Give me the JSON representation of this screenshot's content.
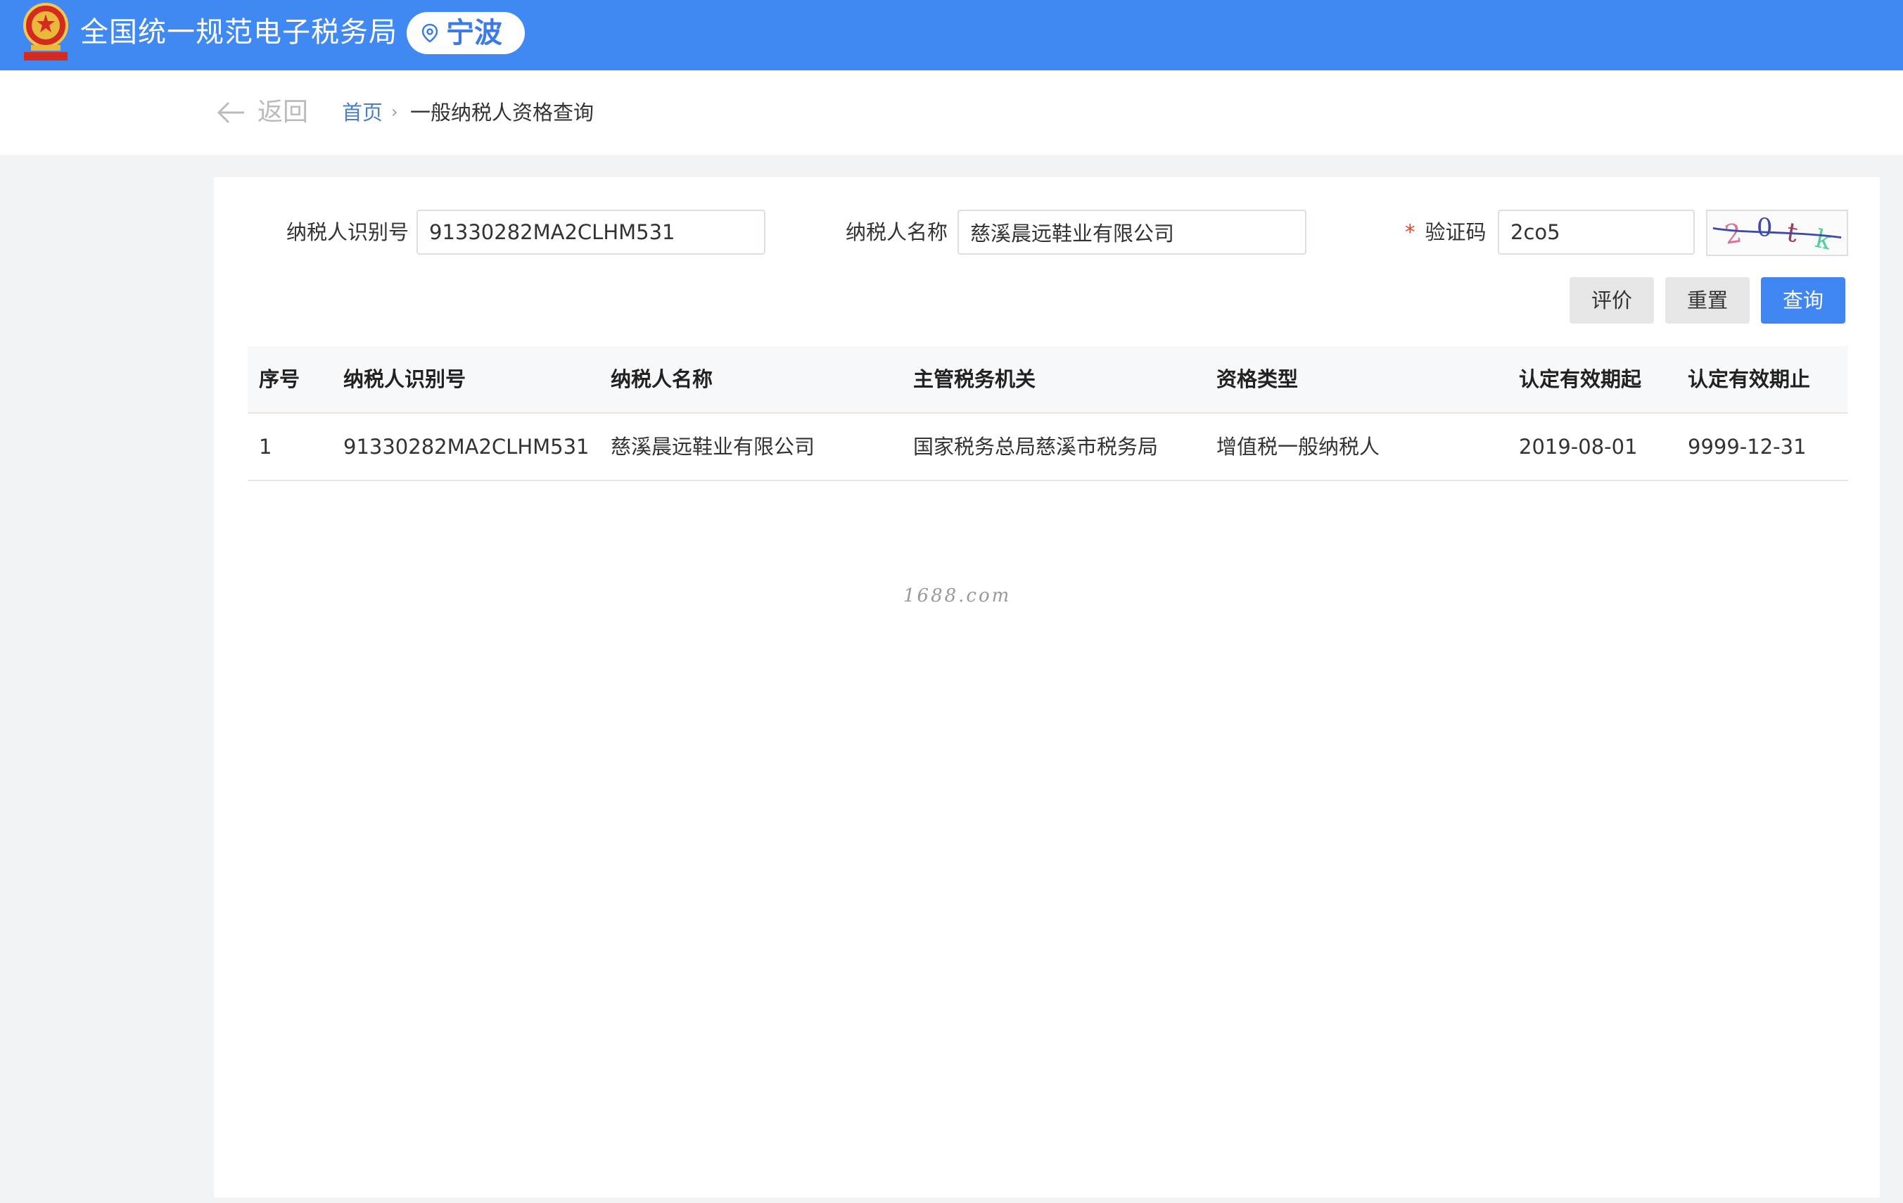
{
  "header": {
    "site_title": "全国统一规范电子税务局",
    "city": "宁波",
    "emblem_icon": "national-emblem-icon",
    "accent_color": "#4189f2"
  },
  "breadcrumb": {
    "back_label": "返回",
    "home_label": "首页",
    "separator": "›",
    "current": "一般纳税人资格查询"
  },
  "form": {
    "taxpayer_id_label": "纳税人识别号",
    "taxpayer_id_value": "91330282MA2CLHM531",
    "taxpayer_name_label": "纳税人名称",
    "taxpayer_name_value": "慈溪晨远鞋业有限公司",
    "captcha_required": "*",
    "captcha_label": "验证码",
    "captcha_value": "2co5",
    "captcha_image_text": "20tk"
  },
  "actions": {
    "evaluate_label": "评价",
    "reset_label": "重置",
    "query_label": "查询",
    "primary_color": "#3f86f2"
  },
  "table": {
    "columns": [
      "序号",
      "纳税人识别号",
      "纳税人名称",
      "主管税务机关",
      "资格类型",
      "认定有效期起",
      "认定有效期止"
    ],
    "rows": [
      [
        "1",
        "91330282MA2CLHM531",
        "慈溪晨远鞋业有限公司",
        "国家税务总局慈溪市税务局",
        "增值税一般纳税人",
        "2019-08-01",
        "9999-12-31"
      ]
    ]
  },
  "watermark": "1688.com"
}
